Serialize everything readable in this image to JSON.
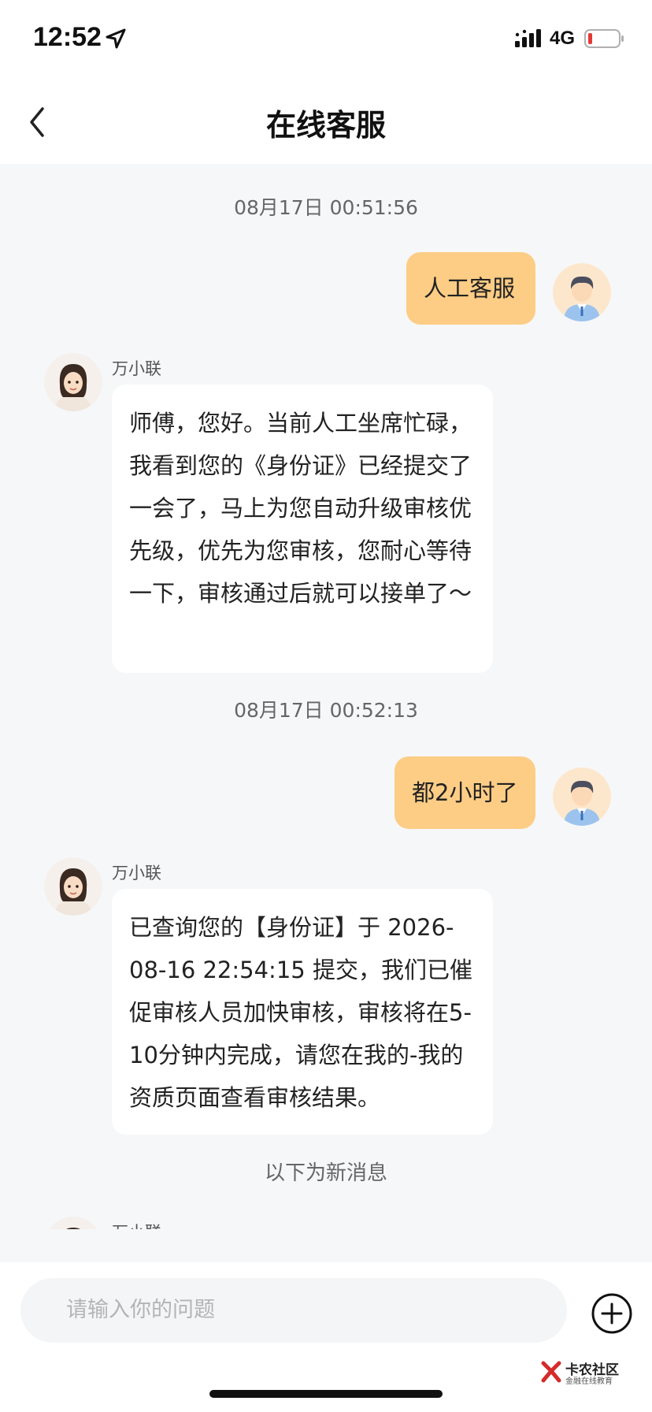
{
  "status_bar": {
    "time": "12:52",
    "network": "4G"
  },
  "header": {
    "title": "在线客服"
  },
  "messages": {
    "ts1": "08月17日 00:51:56",
    "user1": "人工客服",
    "agent_name": "万小联",
    "agent1": "师傅，您好。当前人工坐席忙碌，我看到您的《身份证》已经提交了一会了，马上为您自动升级审核优先级，优先为您审核，您耐心等待一下，审核通过后就可以接单了～",
    "ts2": "08月17日 00:52:13",
    "user2": "都2小时了",
    "agent2": "已查询您的【身份证】于 2026-08-16 22:54:15 提交，我们已催促审核人员加快审核，审核将在5-10分钟内完成，请您在我的-我的资质页面查看审核结果。",
    "new_divider": "以下为新消息"
  },
  "input": {
    "placeholder": "请输入你的问题"
  },
  "watermark": {
    "text": "卡农社区",
    "sub": "金融在线教育"
  },
  "colors": {
    "user_bubble": "#fdcd85",
    "chat_bg": "#f6f7f9"
  }
}
